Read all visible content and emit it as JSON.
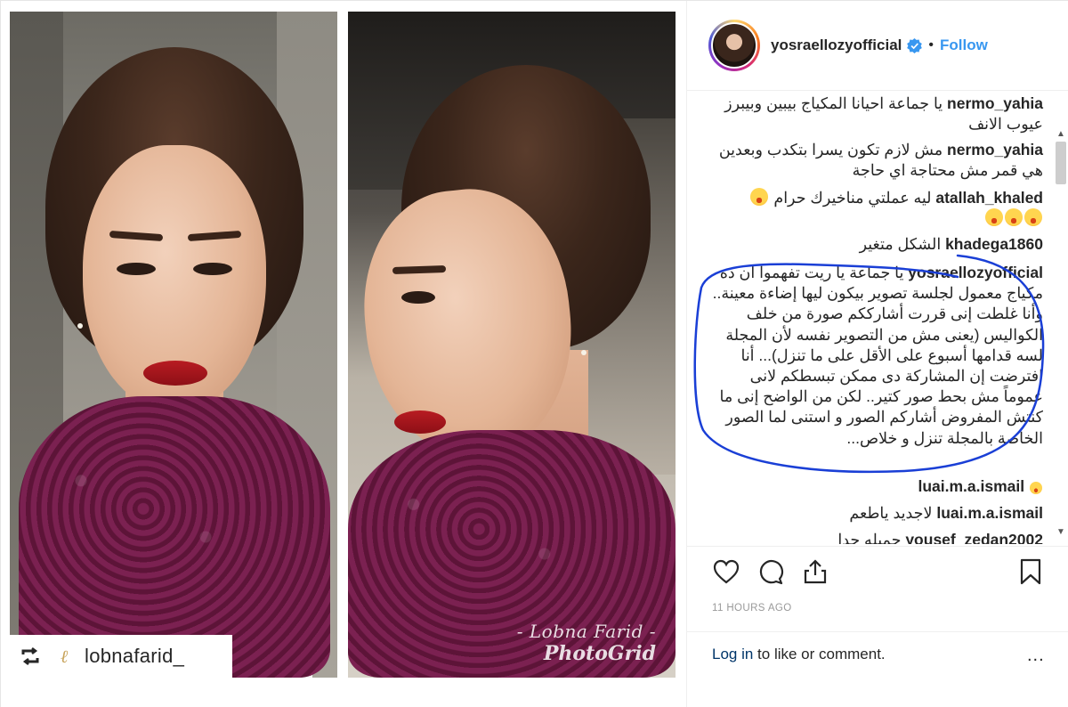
{
  "post": {
    "username": "yosraellozyofficial",
    "follow_label": "Follow",
    "separator": "•",
    "time_ago": "11 HOURS AGO",
    "login_link": "Log in",
    "login_rest": " to like or comment.",
    "more_label": "..."
  },
  "media": {
    "watermark_name": "- Lobna Farid -",
    "watermark_app": "PhotoGrid",
    "regram_user": "lobnafarid_",
    "regram_logo": "ℓ"
  },
  "comments": [
    {
      "user": "nermo_yahia",
      "text": "يا جماعة احيانا المكياج بيبين وبيبرز عيوب الانف"
    },
    {
      "user": "nermo_yahia",
      "text": "مش لازم تكون يسرا بتكدب وبعدين هي قمر مش محتاجة اي حاجة"
    },
    {
      "user": "atallah_khaled",
      "text": "ليه عملتي مناخيرك حرام"
    },
    {
      "user": "khadega1860",
      "text": "الشكل متغير"
    },
    {
      "user": "yosraellozyofficial",
      "text": "يا جماعة يا ريت تفهموا ان ده مكياج معمول لجلسة تصوير بيكون ليها إضاءة معينة.. وأنا غلطت إنى قررت أشارككم صورة من خلف الكواليس (يعنى مش من التصوير نفسه لأن المجلة لسه قدامها أسبوع على الأقل على ما تنزل)... أنا افترضت إن المشاركة دى ممكن تبسطكم لانى عموماً مش بحط صور كتير.. لكن من الواضح إنى ما كنتش المفروض أشاركم الصور و استنى لما الصور الخاصة بالمجلة تنزل و خلاص..."
    },
    {
      "user": "luai.m.a.ismail",
      "text": ""
    },
    {
      "user": "luai.m.a.ismail",
      "text": "لاجديد ياطعم"
    },
    {
      "user": "yousef_zedan2002",
      "text": "جميله جدا"
    }
  ],
  "icons": {
    "like": "heart-icon",
    "comment": "comment-icon",
    "share": "share-icon",
    "save": "bookmark-icon",
    "regram": "regram-icon",
    "verified": "verified-badge-icon"
  },
  "colors": {
    "follow": "#3897f0",
    "annotation": "#1a3fd6",
    "text": "#262626",
    "muted": "#999999"
  }
}
